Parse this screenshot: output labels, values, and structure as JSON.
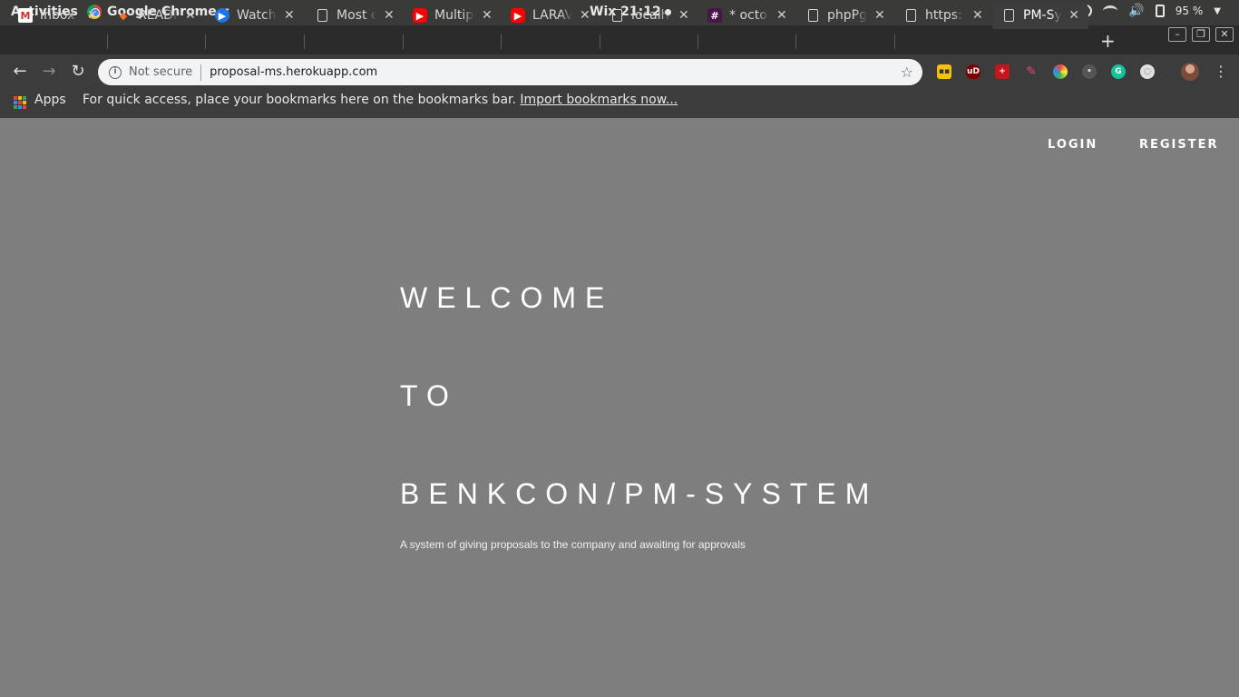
{
  "system_bar": {
    "activities": "Activities",
    "app_name": "Google Chrome",
    "clock": "Wix 21:12",
    "battery": "95 %"
  },
  "tabs": [
    {
      "title": "Inbox (",
      "icon": "gmail-icon"
    },
    {
      "title": "READM",
      "icon": "gitlab-icon"
    },
    {
      "title": "Watch",
      "icon": "watch-icon"
    },
    {
      "title": "Most c",
      "icon": "document-icon"
    },
    {
      "title": "Multipl",
      "icon": "youtube-icon"
    },
    {
      "title": "LARAV",
      "icon": "youtube-icon"
    },
    {
      "title": "localhc",
      "icon": "document-icon"
    },
    {
      "title": "* octo",
      "icon": "slack-icon"
    },
    {
      "title": "phpPg",
      "icon": "document-icon"
    },
    {
      "title": "https:",
      "icon": "document-icon"
    },
    {
      "title": "PM-Sy",
      "icon": "document-icon",
      "active": true
    }
  ],
  "toolbar": {
    "security_label": "Not secure",
    "url": "proposal-ms.herokuapp.com"
  },
  "bookmarks_bar": {
    "apps_label": "Apps",
    "hint": "For quick access, place your bookmarks here on the bookmarks bar.",
    "import_link": "Import bookmarks now..."
  },
  "page": {
    "nav": {
      "login": "LOGIN",
      "register": "REGISTER"
    },
    "hero": {
      "line1": "WELCOME",
      "line2": "TO",
      "line3": "BENKCON/PM-SYSTEM",
      "subtitle": "A system of giving proposals to the company and awaiting for approvals"
    }
  },
  "colors": {
    "page_background": "#7e7e7e",
    "chrome_dark": "#3c3c3c",
    "top_bar": "#3a3a38"
  }
}
